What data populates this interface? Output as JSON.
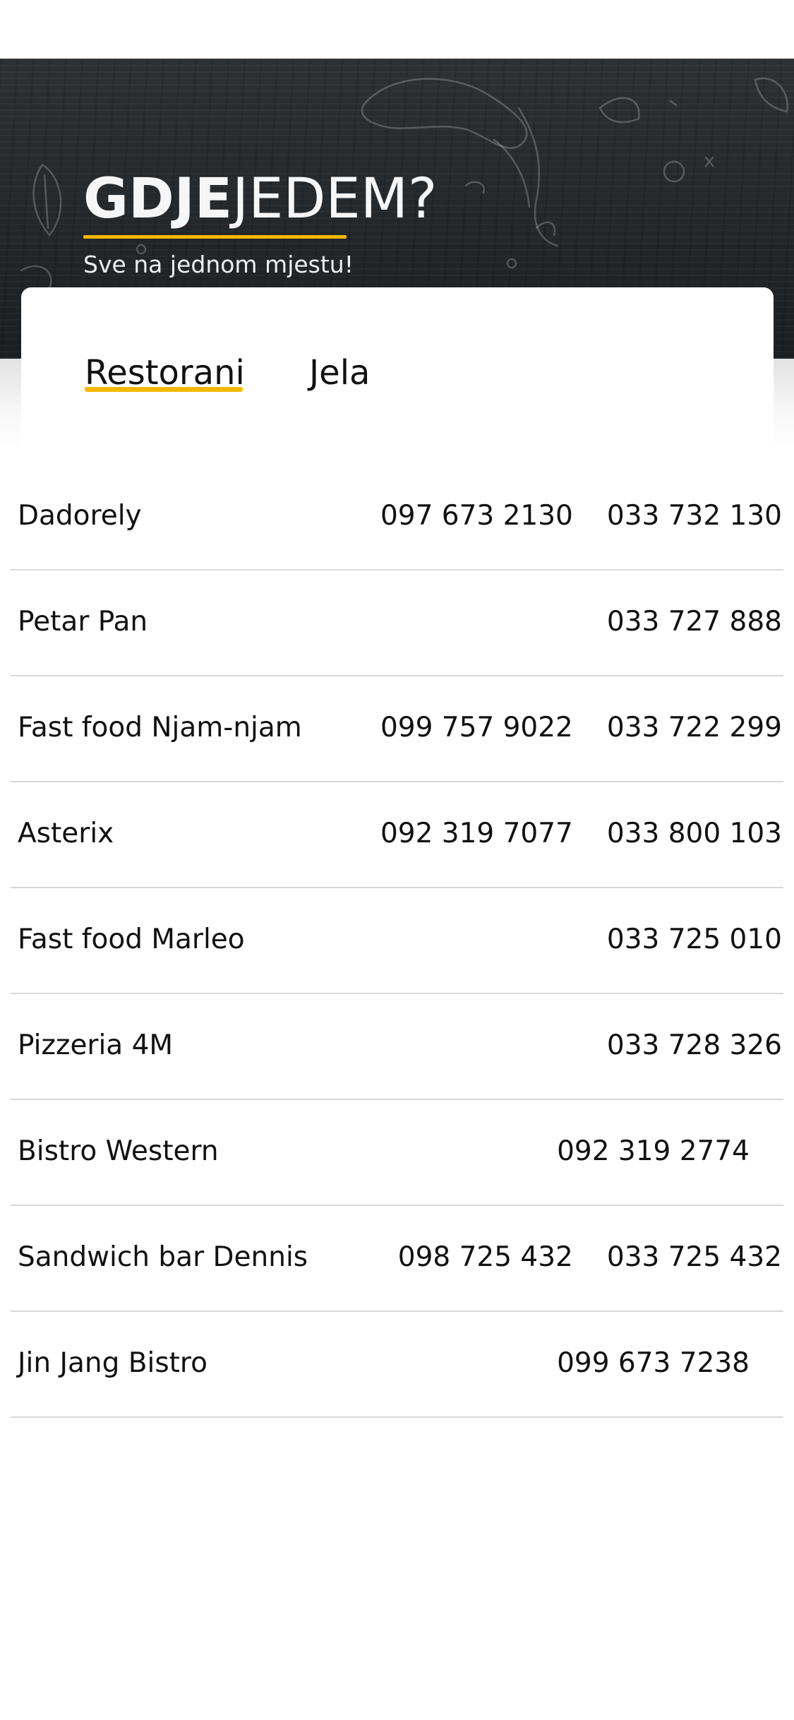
{
  "header": {
    "logo_bold": "GDJE",
    "logo_light": "JEDEM?",
    "tagline": "Sve na jednom mjestu!",
    "accent_color": "#f5b800"
  },
  "tabs": [
    {
      "label": "Restorani",
      "active": true
    },
    {
      "label": "Jela",
      "active": false
    }
  ],
  "restaurants": [
    {
      "name": "Dadorely",
      "phones": [
        "097 673 2130",
        "033 732 130"
      ]
    },
    {
      "name": "Petar Pan",
      "phones": [
        "033 727 888"
      ]
    },
    {
      "name": "Fast food Njam-njam",
      "phones": [
        "099 757 9022",
        "033 722 299"
      ]
    },
    {
      "name": "Asterix",
      "phones": [
        "092 319 7077",
        "033 800 103"
      ]
    },
    {
      "name": "Fast food Marleo",
      "phones": [
        "033 725 010"
      ]
    },
    {
      "name": "Pizzeria 4M",
      "phones": [
        "033 728 326"
      ]
    },
    {
      "name": "Bistro Western",
      "phones": [
        "092 319 2774"
      ]
    },
    {
      "name": "Sandwich bar Dennis",
      "phones": [
        "098 725 432",
        "033 725 432"
      ]
    },
    {
      "name": "Jin Jang Bistro",
      "phones": [
        "099 673 7238"
      ]
    }
  ]
}
